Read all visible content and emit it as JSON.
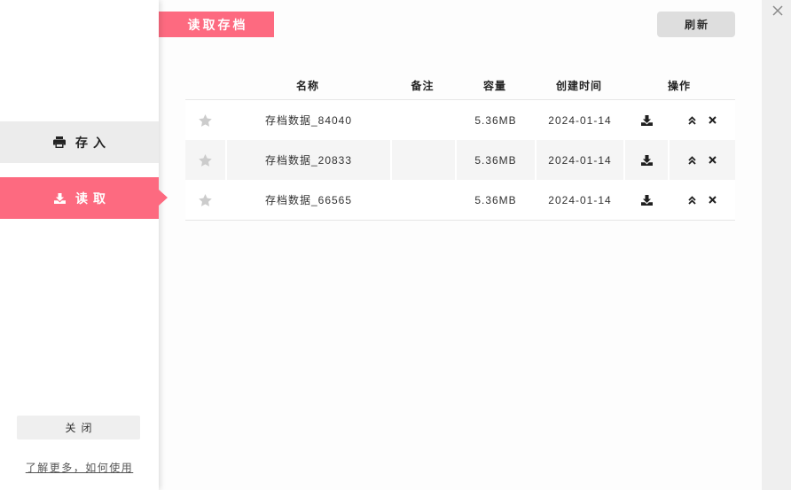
{
  "sidebar": {
    "save_label": "存入",
    "load_label": "读取",
    "close_label": "关闭",
    "help_link": "了解更多，如何使用"
  },
  "header": {
    "title": "读取存档",
    "refresh_label": "刷新"
  },
  "table": {
    "columns": {
      "name": "名称",
      "note": "备注",
      "size": "容量",
      "created": "创建时间",
      "actions": "操作"
    },
    "rows": [
      {
        "name": "存档数据_84040",
        "note": "",
        "size": "5.36MB",
        "created": "2024-01-14"
      },
      {
        "name": "存档数据_20833",
        "note": "",
        "size": "5.36MB",
        "created": "2024-01-14"
      },
      {
        "name": "存档数据_66565",
        "note": "",
        "size": "5.36MB",
        "created": "2024-01-14"
      }
    ]
  },
  "icons": {
    "save": "printer-icon",
    "load": "download-icon",
    "favorite": "star-icon",
    "row_download": "download-icon",
    "move_up": "double-chevron-up-icon",
    "delete": "x-mark-icon",
    "window_close": "close-icon"
  },
  "colors": {
    "accent": "#fd6a80",
    "sidebar_button": "#ececec",
    "close_button": "#efefef",
    "star": "#cccccc",
    "row_alt": "#f5f5f5",
    "refresh_button": "#dedede",
    "right_strip": "#efefef",
    "icon_dark": "#1f1f1f"
  }
}
